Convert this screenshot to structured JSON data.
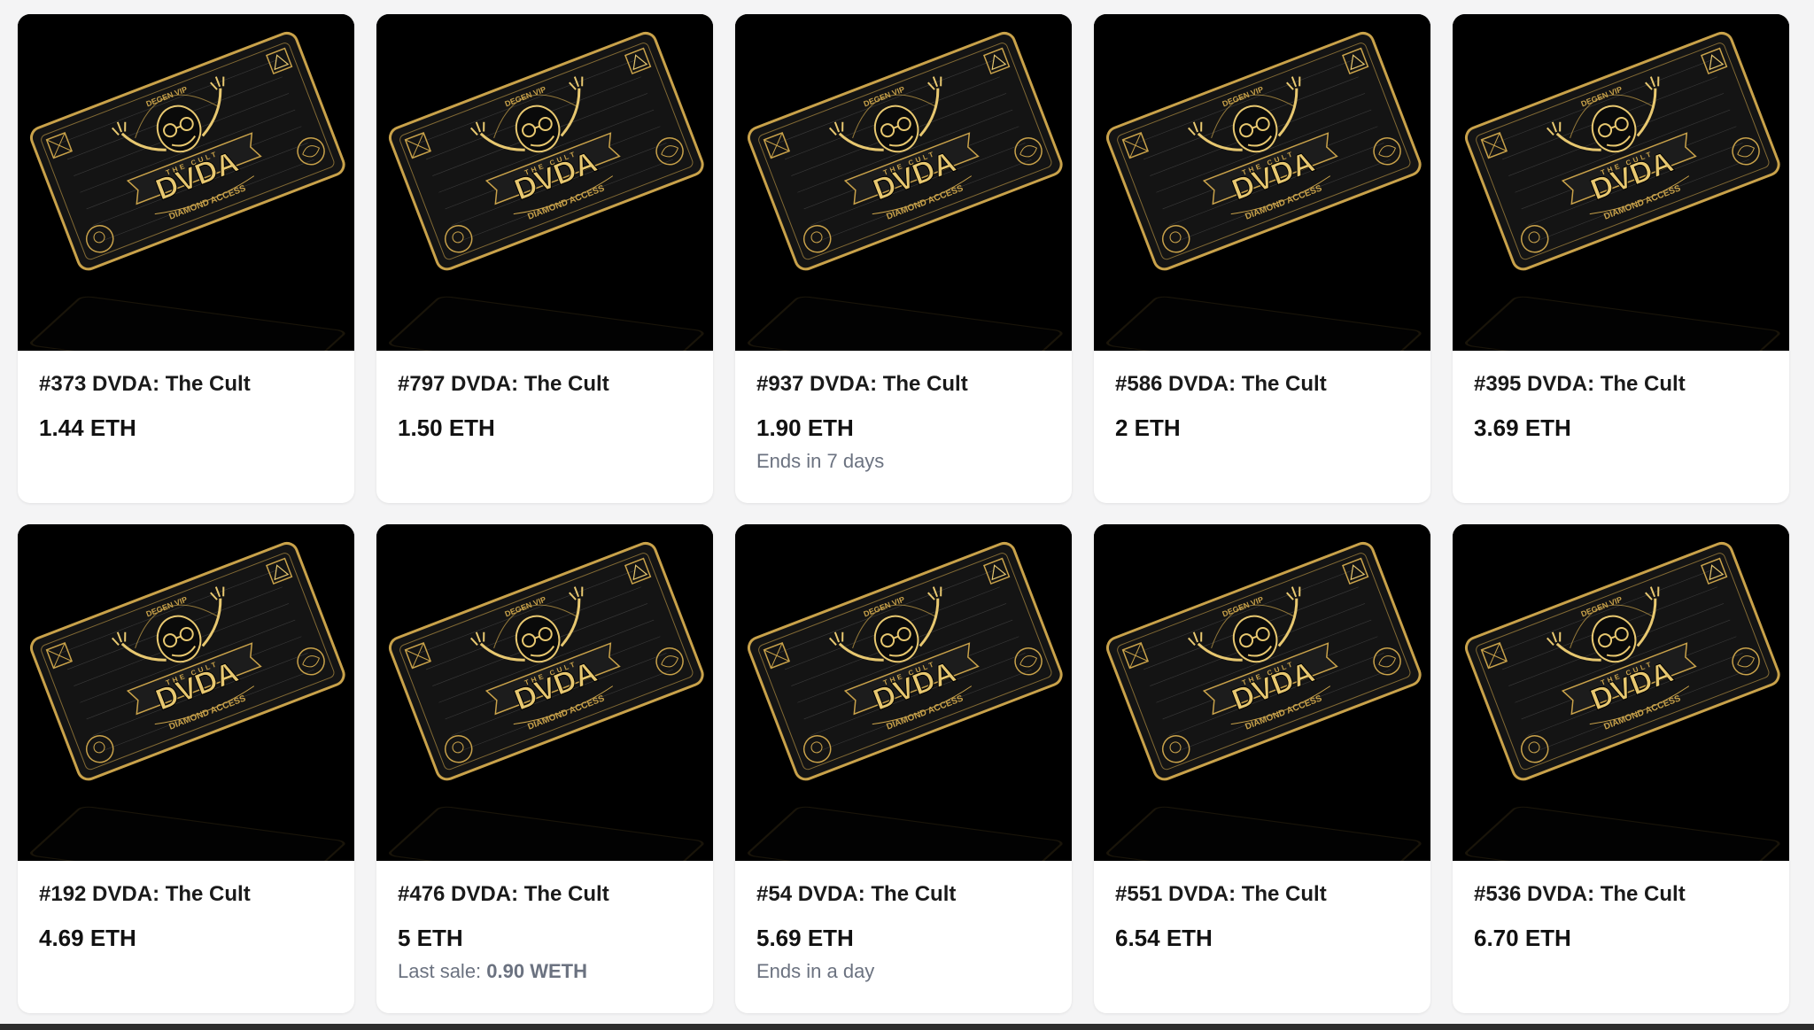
{
  "cards": [
    {
      "title": "#373 DVDA: The Cult",
      "price": "1.44 ETH",
      "sub": ""
    },
    {
      "title": "#797 DVDA: The Cult",
      "price": "1.50 ETH",
      "sub": ""
    },
    {
      "title": "#937 DVDA: The Cult",
      "price": "1.90 ETH",
      "sub": "Ends in 7 days"
    },
    {
      "title": "#586 DVDA: The Cult",
      "price": "2 ETH",
      "sub": ""
    },
    {
      "title": "#395 DVDA: The Cult",
      "price": "3.69 ETH",
      "sub": ""
    },
    {
      "title": "#192 DVDA: The Cult",
      "price": "4.69 ETH",
      "sub": ""
    },
    {
      "title": "#476 DVDA: The Cult",
      "price": "5 ETH",
      "sub_prefix": "Last sale:",
      "sub_value": "0.90 WETH"
    },
    {
      "title": "#54 DVDA: The Cult",
      "price": "5.69 ETH",
      "sub": "Ends in a day"
    },
    {
      "title": "#551 DVDA: The Cult",
      "price": "6.54 ETH",
      "sub": ""
    },
    {
      "title": "#536 DVDA: The Cult",
      "price": "6.70 ETH",
      "sub": ""
    }
  ],
  "artwork": {
    "brand": "DVDA",
    "banner": "THE CULT",
    "top_text": "DEGEN VIP",
    "bottom_text": "DIAMOND ACCESS",
    "gold": "#c9a24a",
    "gold_light": "#e8c870",
    "card_bg": "#141414"
  }
}
